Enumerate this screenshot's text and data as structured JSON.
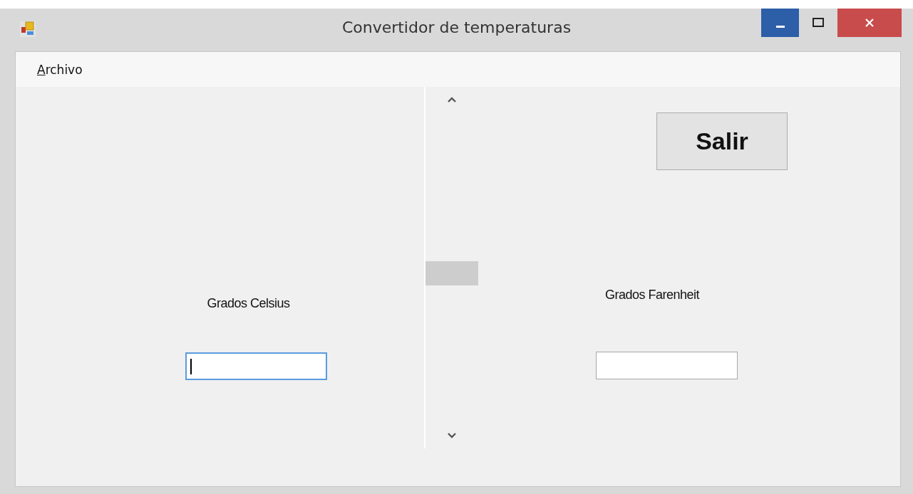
{
  "window": {
    "title": "Convertidor de temperaturas"
  },
  "menu": [
    {
      "label": "Archivo",
      "mnemonic_first": true
    }
  ],
  "celsius": {
    "label": "Grados Celsius",
    "focused": true
  },
  "fahrenheit": {
    "label": "Grados Farenheit",
    "focused": false
  },
  "buttons": [
    {
      "label": "Salir"
    }
  ]
}
